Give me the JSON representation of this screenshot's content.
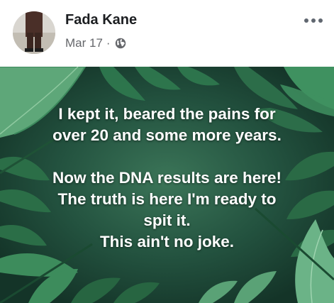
{
  "post": {
    "author_name": "Fada Kane",
    "date": "Mar 17",
    "separator": "·",
    "privacy_icon": "globe-icon",
    "more_icon": "more-options-icon",
    "text_lines": [
      "I kept it, beared the pains for",
      "over 20 and some more years.",
      "",
      "Now the DNA results are here!",
      "The truth is here I'm ready to",
      "spit it.",
      "This ain't no joke."
    ]
  },
  "colors": {
    "author": "#1c1e21",
    "meta": "#65676b",
    "background_dark": "#1f4a3a",
    "leaf_light": "#5fa377",
    "text": "#ffffff"
  }
}
